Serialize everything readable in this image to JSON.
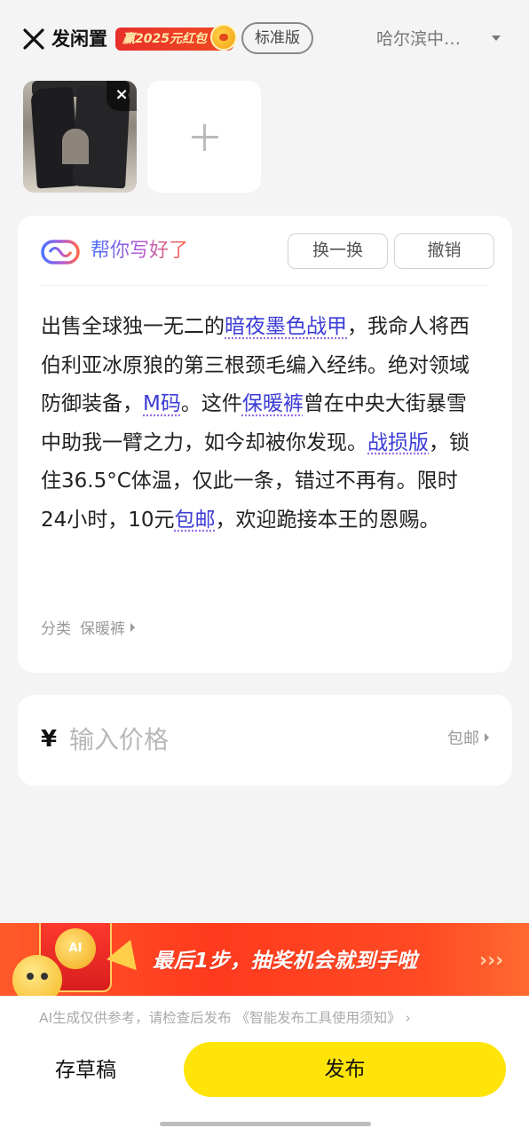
{
  "header": {
    "title": "发闲置",
    "promo_badge": "赢2025元红包",
    "mode_label": "标准版",
    "location": "哈尔滨中…"
  },
  "photos": {
    "remove_icon": "×",
    "add_icon": "+"
  },
  "ai_card": {
    "title": "帮你写好了",
    "swap_label": "换一换",
    "undo_label": "撤销",
    "description_parts": [
      {
        "text": "出售全球独一无二的",
        "hl": false
      },
      {
        "text": "暗夜墨色战甲",
        "hl": true
      },
      {
        "text": "，我命人将西伯利亚冰原狼的第三根颈毛编入经纬。绝对领域防御装备，",
        "hl": false
      },
      {
        "text": "M码",
        "hl": true
      },
      {
        "text": "。这件",
        "hl": false
      },
      {
        "text": "保暖裤",
        "hl": true
      },
      {
        "text": "曾在中央大街暴雪中助我一臂之力，如今却被你发现。",
        "hl": false
      },
      {
        "text": "战损版",
        "hl": true
      },
      {
        "text": "，锁住36.5°C体温，仅此一条，错过不再有。限时24小时，10元",
        "hl": false
      },
      {
        "text": "包邮",
        "hl": true
      },
      {
        "text": "，欢迎跪接本王的恩赐。",
        "hl": false
      }
    ],
    "category_label": "分类",
    "category_value": "保暖裤"
  },
  "price": {
    "currency": "¥",
    "placeholder": "输入价格",
    "shipping_label": "包邮"
  },
  "banner": {
    "coin_label": "AI",
    "text": "最后1步，抽奖机会就到手啦",
    "chevrons": "›››"
  },
  "footer": {
    "disclaimer": "AI生成仅供参考，请检查后发布 《智能发布工具使用须知》 ›",
    "draft_label": "存草稿",
    "publish_label": "发布"
  },
  "colors": {
    "accent_yellow": "#ffe40a",
    "highlight_blue": "#3b3bd6",
    "banner_red": "#ff3a1e"
  }
}
